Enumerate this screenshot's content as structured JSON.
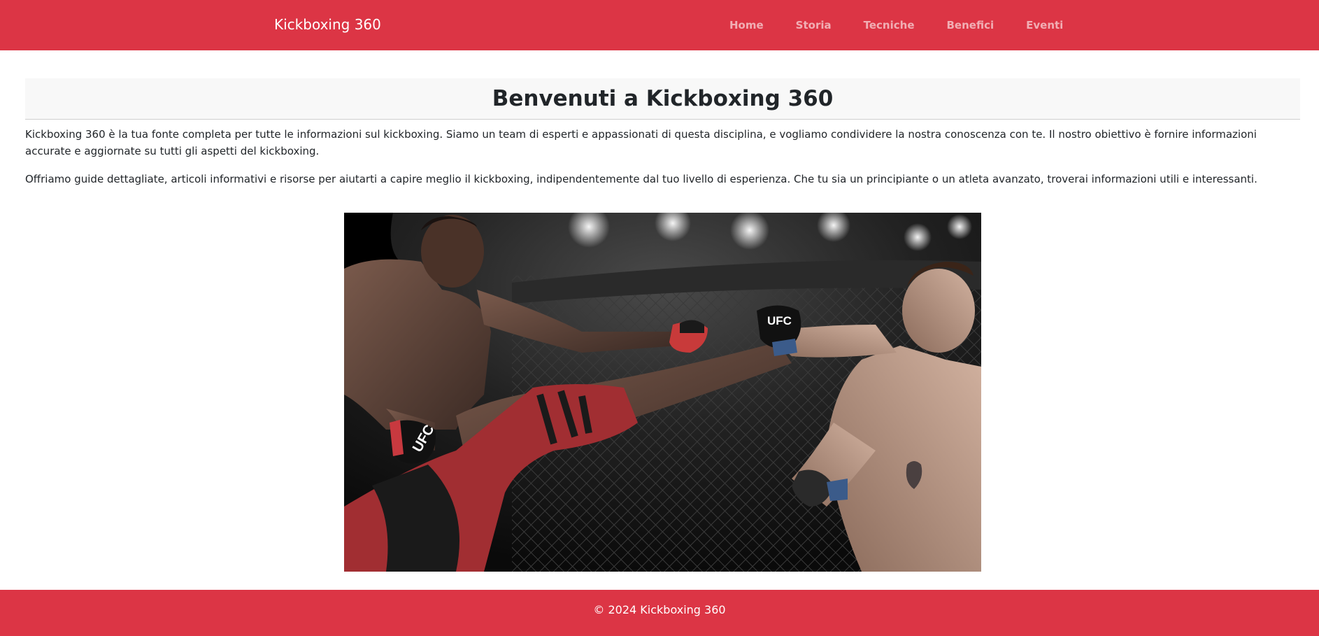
{
  "nav": {
    "brand": "Kickboxing 360",
    "items": [
      {
        "label": "Home"
      },
      {
        "label": "Storia"
      },
      {
        "label": "Tecniche"
      },
      {
        "label": "Benefici"
      },
      {
        "label": "Eventi"
      }
    ]
  },
  "hero": {
    "title": "Benvenuti a Kickboxing 360"
  },
  "content": {
    "paragraphs": [
      "Kickboxing 360 è la tua fonte completa per tutte le informazioni sul kickboxing. Siamo un team di esperti e appassionati di questa disciplina, e vogliamo condividere la nostra conoscenza con te. Il nostro obiettivo è fornire informazioni accurate e aggiornate su tutti gli aspetti del kickboxing.",
      "Offriamo guide dettagliate, articoli informativi e risorse per aiutarti a capire meglio il kickboxing, indipendentemente dal tuo livello di esperienza. Che tu sia un principiante o un atleta avanzato, troverai informazioni utili e interessanti."
    ]
  },
  "image": {
    "glove_text": "UFC"
  },
  "footer": {
    "text": "© 2024 Kickboxing 360"
  },
  "colors": {
    "primary": "#dc3545",
    "hero_bg": "#f8f8f8",
    "text": "#212529"
  }
}
